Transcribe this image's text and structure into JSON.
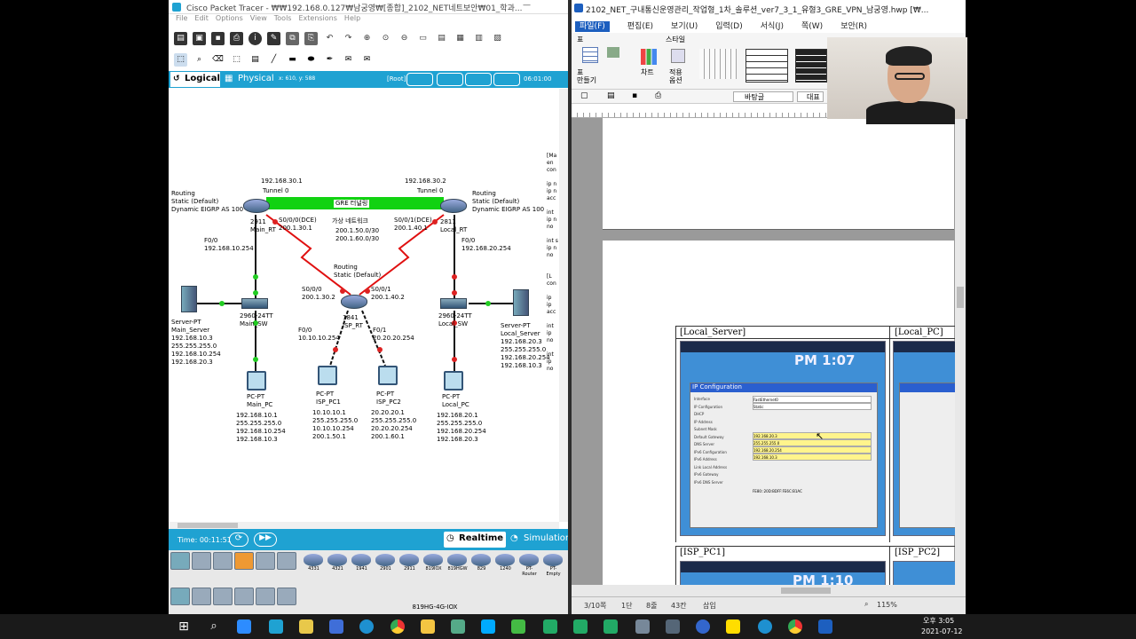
{
  "packet_tracer": {
    "title": "Cisco Packet Tracer - ₩₩192.168.0.127₩남궁영₩[종합]_2102_NET네트보안₩01_학과...",
    "menu": [
      "File",
      "Edit",
      "Options",
      "View",
      "Tools",
      "Extensions",
      "Help"
    ],
    "mode_logical": "Logical",
    "mode_physical": "Physical",
    "coords": "x: 610, y: 588",
    "root": "[Root]",
    "clock": "06:01:00",
    "labels": {
      "tunnel_left_ip": "192.168.30.1",
      "tunnel_left": "Tunnel 0",
      "tunnel_right_ip": "192.168.30.2",
      "tunnel_right": "Tunnel 0",
      "gre": "GRE 터널링",
      "virtual_net": "가상 네트워크",
      "virtual_net_ips": "200.1.50.0/30\n200.1.60.0/30",
      "routing_left": "Routing\nStatic (Default)\nDynamic EIGRP AS 100",
      "routing_right": "Routing\nStatic (Default)\nDynamic EIGRP AS 100",
      "routing_isp": "Routing\nStatic (Default)",
      "main_rt": "2911\nMain_RT",
      "local_rt": "2811\nLocal_RT",
      "isp_rt": "1841\nISP_RT",
      "main_s0": "S0/0/0(DCE)\n200.1.30.1",
      "local_s0": "S0/0/1(DCE)\n200.1.40.1",
      "main_f0": "F0/0\n192.168.10.254",
      "local_f0": "F0/0\n192.168.20.254",
      "isp_s000": "S0/0/0\n200.1.30.2",
      "isp_s001": "S0/0/1\n200.1.40.2",
      "isp_f00": "F0/0\n10.10.10.254",
      "isp_f01": "F0/1\n20.20.20.254",
      "main_sw": "2960-24TT\nMain_SW",
      "local_sw": "2960-24TT\nLocal_SW",
      "main_server": "Server-PT\nMain_Server\n192.168.10.3\n255.255.255.0\n192.168.10.254\n192.168.20.3",
      "local_server": "Server-PT\nLocal_Server\n192.168.20.3\n255.255.255.0\n192.168.20.254\n192.168.10.3",
      "main_pc": "PC-PT\nMain_PC",
      "main_pc_ip": "192.168.10.1\n255.255.255.0\n192.168.10.254\n192.168.10.3",
      "isp_pc1": "PC-PT\nISP_PC1",
      "isp_pc1_ip": "10.10.10.1\n255.255.255.0\n10.10.10.254\n200.1.50.1",
      "isp_pc2": "PC-PT\nISP_PC2",
      "isp_pc2_ip": "20.20.20.1\n255.255.255.0\n20.20.20.254\n200.1.60.1",
      "local_pc": "PC-PT\nLocal_PC",
      "local_pc_ip": "192.168.20.1\n255.255.255.0\n192.168.20.254\n192.168.20.3",
      "side_notes": "[Ma\nen\ncon\n\nip n\nip n\nacc\n\nint\nip n\nno\n\nint s\nip n\nno\n\n\n[L\ncon\n\nip\nip\nacc\n\nint\nip\nno\n\nint\nip\nno"
    },
    "time": "Time: 00:11:51",
    "realtime": "Realtime",
    "simulation": "Simulation",
    "device_models": [
      "4331",
      "4321",
      "1941",
      "2901",
      "2911",
      "819IOX",
      "819HGW",
      "829",
      "1240",
      "PT-Router",
      "PT-Empty"
    ],
    "selected_device": "819HG-4G-IOX"
  },
  "hwp": {
    "title": "2102_NET_구내통신운영관리_작업형_1차_솔루션_ver7_3_1_유형3_GRE_VPN_남궁영.hwp [₩...",
    "menu": [
      "파일(F)",
      "편집(E)",
      "보기(U)",
      "입력(D)",
      "서식(J)",
      "쪽(W)",
      "보안(R)"
    ],
    "ribbon_group_table": "표",
    "ribbon_style": "스타일",
    "ribbon_labels": [
      "표\n만들기",
      "차트",
      "적용\n옵션"
    ],
    "font_name": "바탕글",
    "font_style": "대표",
    "captions": [
      "[Local_Server]",
      "[Local_PC]",
      "[ISP_PC1]",
      "[ISP_PC2]"
    ],
    "pm_label": "PM 1:07",
    "pm_label2": "PM 1:10",
    "ip_config": "IP Configuration",
    "ip_fields": [
      "Interface",
      "IP Configuration",
      "DHCP",
      "IP Address",
      "Subnet Mask",
      "Default Gateway",
      "DNS Server",
      "IPv6 Configuration",
      "IPv6 Address",
      "Link Local Address",
      "IPv6 Gateway",
      "IPv6 DNS Server"
    ],
    "ip_values": [
      "FastEthernet0",
      "Static",
      "192.168.20.3",
      "255.255.255.0",
      "192.168.20.254",
      "192.168.10.3"
    ],
    "link_local": "FE80::20D:BDFF:FE6C:B1AC",
    "status": {
      "page": "3/10쪽",
      "section": "1단",
      "line": "8줄",
      "col": "43칸",
      "insert": "삽입",
      "zoom": "115%"
    }
  },
  "taskbar": {
    "time": "오후 3:05",
    "date": "2021-07-12"
  },
  "colors": {
    "pt_blue": "#1fa2d2",
    "gre_green": "#11d211",
    "link_red": "#e01010",
    "hwp_blue": "#1d5fbf"
  }
}
